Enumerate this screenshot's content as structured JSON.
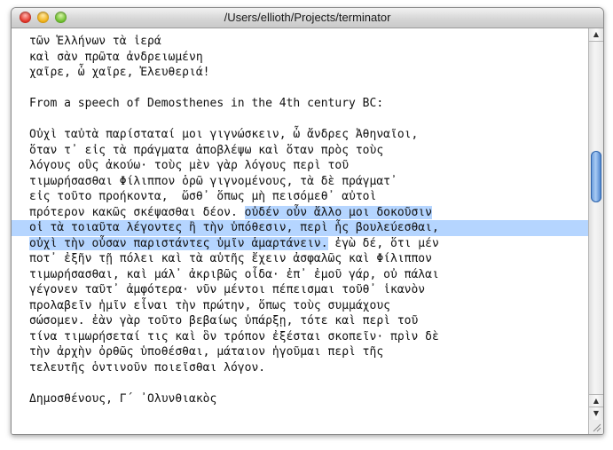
{
  "window": {
    "title": "/Users/ellioth/Projects/terminator"
  },
  "document": {
    "lines": [
      {
        "text": "τῶν Ἑλλήνων τὰ ἱερά"
      },
      {
        "text": "καὶ σὰν πρῶτα ἀνδρειωμένη"
      },
      {
        "text": "χαῖρε, ὦ χαῖρε, Ἐλευθεριά!"
      },
      {
        "text": ""
      },
      {
        "text": "From a speech of Demosthenes in the 4th century BC:"
      },
      {
        "text": ""
      },
      {
        "text": "Οὐχὶ ταὐτὰ παρίσταταί μοι γιγνώσκειν, ὦ ἄνδρες Ἀθηναῖοι,"
      },
      {
        "text": "ὅταν τ᾽ εἰς τὰ πράγματα ἀποβλέψω καὶ ὅταν πρὸς τοὺς"
      },
      {
        "text": "λόγους οὓς ἀκούω· τοὺς μὲν γὰρ λόγους περὶ τοῦ"
      },
      {
        "text": "τιμωρήσασθαι Φίλιππον ὁρῶ γιγνομένους, τὰ δὲ πράγματ᾽"
      },
      {
        "text": "εἰς τοῦτο προήκοντα,  ὥσθ᾽ ὅπως μὴ πεισόμεθ᾽ αὐτοὶ"
      },
      {
        "text": "πρότερον κακῶς σκέψασθαι δέον. ",
        "sel": "οὐδέν οὖν ἄλλο μοι δοκοῦσιν"
      },
      {
        "text": "",
        "sel": "οἱ τὰ τοιαῦτα λέγοντες ἢ τὴν ὑπόθεσιν, περὶ ἧς βουλεύεσθαι,",
        "full": true
      },
      {
        "text": "",
        "sel": "οὐχὶ τὴν οὖσαν παριστάντες ὑμῖν ἁμαρτάνειν.",
        "after": " ἐγὼ δέ, ὅτι μέν"
      },
      {
        "text": "ποτ᾽ ἐξῆν τῇ πόλει καὶ τὰ αὑτῆς ἔχειν ἀσφαλῶς καὶ Φίλιππον"
      },
      {
        "text": "τιμωρήσασθαι, καὶ μάλ᾽ ἀκριβῶς οἶδα· ἐπ᾽ ἐμοῦ γάρ, οὐ πάλαι"
      },
      {
        "text": "γέγονεν ταῦτ᾽ ἀμφότερα· νῦν μέντοι πέπεισμαι τοῦθ᾽ ἱκανὸν"
      },
      {
        "text": "προλαβεῖν ἡμῖν εἶναι τὴν πρώτην, ὅπως τοὺς συμμάχους"
      },
      {
        "text": "σώσομεν. ἐὰν γὰρ τοῦτο βεβαίως ὑπάρξῃ, τότε καὶ περὶ τοῦ"
      },
      {
        "text": "τίνα τιμωρήσεταί τις καὶ ὃν τρόπον ἐξέσται σκοπεῖν· πρὶν δὲ"
      },
      {
        "text": "τὴν ἀρχὴν ὀρθῶς ὑποθέσθαι, μάταιον ἡγοῦμαι περὶ τῆς"
      },
      {
        "text": "τελευτῆς ὁντινοῦν ποιεῖσθαι λόγον."
      },
      {
        "text": ""
      },
      {
        "text": "Δημοσθένους, Γ´ ᾿Ολυνθιακὸς"
      }
    ]
  },
  "colors": {
    "selection": "#b5d5ff",
    "scroll_thumb": "#5d92d6"
  },
  "icons": {
    "close": "close-traffic-light-icon",
    "minimize": "minimize-traffic-light-icon",
    "zoom": "zoom-traffic-light-icon",
    "scroll_up": "scroll-up-arrow-icon",
    "scroll_down": "scroll-down-arrow-icon",
    "resize": "resize-grip-icon"
  }
}
